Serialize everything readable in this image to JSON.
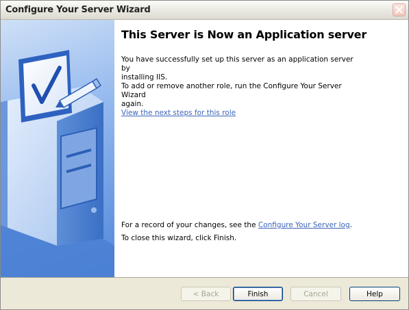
{
  "window": {
    "title": "Configure Your Server Wizard"
  },
  "main": {
    "heading": "This Server is Now an Application server",
    "success_line1": "You have successfully set up this server as an application server by",
    "success_line2": "installing IIS.",
    "role_line1": "To add or remove another role, run the Configure Your Server Wizard",
    "role_line2": "again.",
    "next_steps_link": "View the next steps for this role",
    "record_prefix": "For a record of your changes, see the ",
    "log_link": "Configure Your Server log",
    "record_suffix": ".",
    "close_text": "To close this wizard, click Finish."
  },
  "buttons": {
    "back": "< Back",
    "finish": "Finish",
    "cancel": "Cancel",
    "help": "Help"
  },
  "colors": {
    "link": "#3a64b8",
    "side_panel": "#4f86d9"
  },
  "icons": {
    "close": "close-icon",
    "side_illustration": "server-checklist-illustration"
  }
}
